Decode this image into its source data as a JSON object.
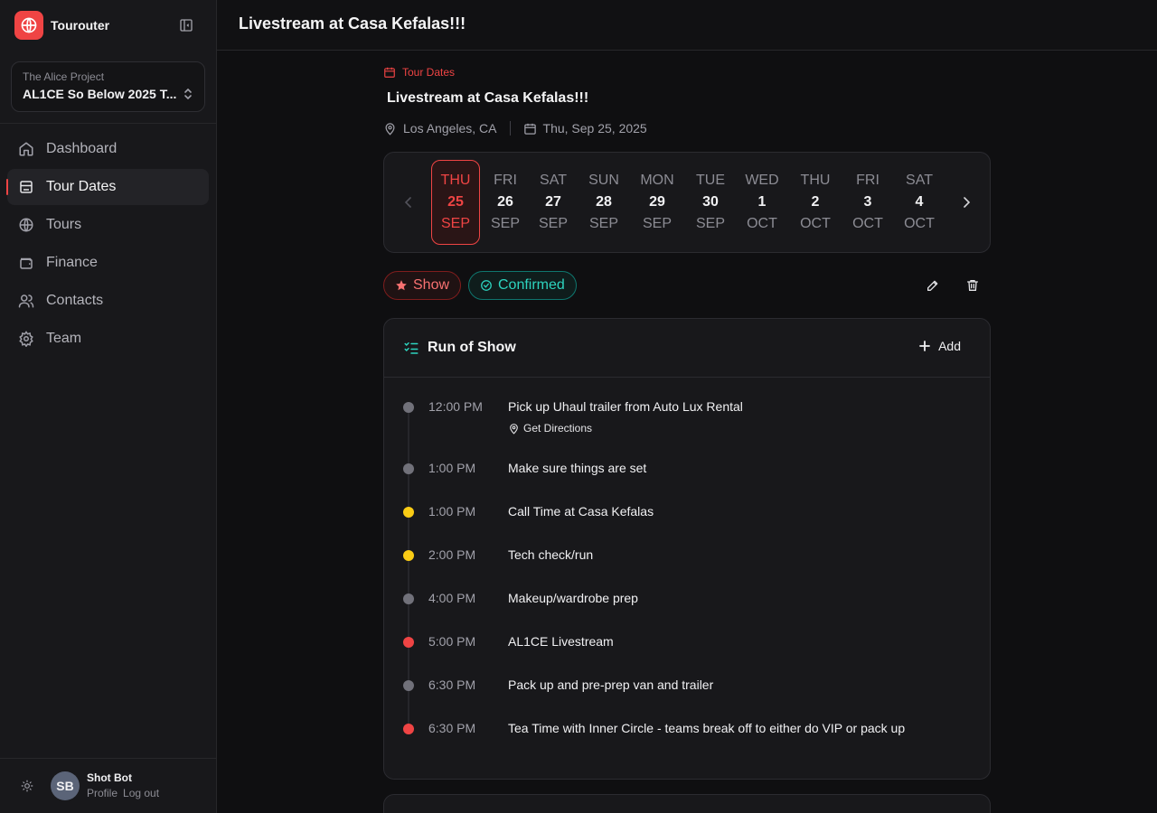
{
  "app": {
    "name": "Tourouter"
  },
  "project": {
    "org": "The Alice Project",
    "name": "AL1CE So Below 2025 T..."
  },
  "nav": {
    "items": [
      {
        "label": "Dashboard",
        "icon": "home-icon"
      },
      {
        "label": "Tour Dates",
        "icon": "tour-dates-icon",
        "active": true
      },
      {
        "label": "Tours",
        "icon": "globe-icon"
      },
      {
        "label": "Finance",
        "icon": "wallet-icon"
      },
      {
        "label": "Contacts",
        "icon": "users-icon"
      },
      {
        "label": "Team",
        "icon": "gear-icon"
      }
    ]
  },
  "user": {
    "initials": "SB",
    "name": "Shot Bot",
    "profile_label": "Profile",
    "logout_label": "Log out"
  },
  "header": {
    "title": "Livestream at Casa Kefalas!!!"
  },
  "event": {
    "breadcrumb": "Tour Dates",
    "title": "Livestream at Casa Kefalas!!!",
    "location": "Los Angeles, CA",
    "date": "Thu, Sep 25, 2025"
  },
  "date_strip": {
    "days": [
      {
        "dow": "THU",
        "num": "25",
        "mon": "SEP",
        "selected": true
      },
      {
        "dow": "FRI",
        "num": "26",
        "mon": "SEP"
      },
      {
        "dow": "SAT",
        "num": "27",
        "mon": "SEP"
      },
      {
        "dow": "SUN",
        "num": "28",
        "mon": "SEP"
      },
      {
        "dow": "MON",
        "num": "29",
        "mon": "SEP"
      },
      {
        "dow": "TUE",
        "num": "30",
        "mon": "SEP"
      },
      {
        "dow": "WED",
        "num": "1",
        "mon": "OCT"
      },
      {
        "dow": "THU",
        "num": "2",
        "mon": "OCT"
      },
      {
        "dow": "FRI",
        "num": "3",
        "mon": "OCT"
      },
      {
        "dow": "SAT",
        "num": "4",
        "mon": "OCT"
      }
    ]
  },
  "badges": {
    "type": "Show",
    "status": "Confirmed"
  },
  "run_of_show": {
    "title": "Run of Show",
    "add_label": "Add",
    "directions_label": "Get Directions",
    "entries": [
      {
        "time": "12:00 PM",
        "text": "Pick up Uhaul trailer from Auto Lux Rental",
        "status": "gray"
      },
      {
        "time": "1:00 PM",
        "text": "Make sure things are set",
        "status": "gray"
      },
      {
        "time": "1:00 PM",
        "text": "Call Time at Casa Kefalas",
        "status": "yellow"
      },
      {
        "time": "2:00 PM",
        "text": "Tech check/run",
        "status": "yellow"
      },
      {
        "time": "4:00 PM",
        "text": "Makeup/wardrobe prep",
        "status": "gray"
      },
      {
        "time": "5:00 PM",
        "text": "AL1CE Livestream",
        "status": "red"
      },
      {
        "time": "6:30 PM",
        "text": "Pack up and pre-prep van and trailer",
        "status": "gray"
      },
      {
        "time": "6:30 PM",
        "text": "Tea Time with Inner Circle - teams break off to either do VIP or pack up",
        "status": "red"
      }
    ]
  },
  "colors": {
    "accent": "#ef4444",
    "teal": "#2dd4bf",
    "gray_dot": "#71717a",
    "yellow_dot": "#facc15",
    "red_dot": "#ef4444"
  }
}
